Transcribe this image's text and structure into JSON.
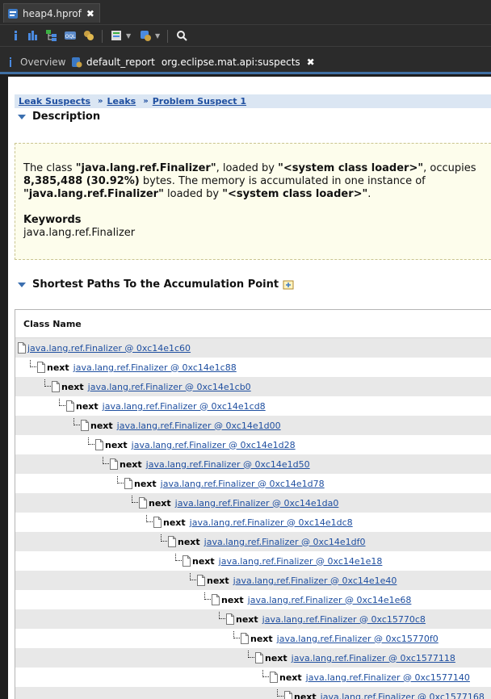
{
  "editor_tab": {
    "title": "heap4.hprof"
  },
  "inner_tabs": [
    {
      "label": "Overview"
    },
    {
      "label": "default_report",
      "sub": "org.eclipse.mat.api:suspects"
    }
  ],
  "breadcrumb": [
    "Leak Suspects",
    "Leaks",
    "Problem Suspect 1"
  ],
  "description": {
    "heading": "Description",
    "l1a": "The class ",
    "l1b": "\"java.lang.ref.Finalizer\"",
    "l1c": ", loaded by ",
    "l1d": "\"<system class loader>\"",
    "l1e": ", occupies",
    "l2a": "8,385,488 (30.92%)",
    "l2b": " bytes. The memory is accumulated in one instance of",
    "l3a": "\"java.lang.ref.Finalizer\"",
    "l3b": " loaded by ",
    "l3c": "\"<system class loader>\"",
    "l3d": ".",
    "keywords_title": "Keywords",
    "keywords": "java.lang.ref.Finalizer"
  },
  "paths": {
    "heading": "Shortest Paths To the Accumulation Point",
    "column": "Class Name",
    "next_label": "next",
    "rows": [
      "java.lang.ref.Finalizer @ 0xc14e1c60",
      "java.lang.ref.Finalizer @ 0xc14e1c88",
      "java.lang.ref.Finalizer @ 0xc14e1cb0",
      "java.lang.ref.Finalizer @ 0xc14e1cd8",
      "java.lang.ref.Finalizer @ 0xc14e1d00",
      "java.lang.ref.Finalizer @ 0xc14e1d28",
      "java.lang.ref.Finalizer @ 0xc14e1d50",
      "java.lang.ref.Finalizer @ 0xc14e1d78",
      "java.lang.ref.Finalizer @ 0xc14e1da0",
      "java.lang.ref.Finalizer @ 0xc14e1dc8",
      "java.lang.ref.Finalizer @ 0xc14e1df0",
      "java.lang.ref.Finalizer @ 0xc14e1e18",
      "java.lang.ref.Finalizer @ 0xc14e1e40",
      "java.lang.ref.Finalizer @ 0xc14e1e68",
      "java.lang.ref.Finalizer @ 0xc15770c8",
      "java.lang.ref.Finalizer @ 0xc15770f0",
      "java.lang.ref.Finalizer @ 0xc1577118",
      "java.lang.ref.Finalizer @ 0xc1577140",
      "java.lang.ref.Finalizer @ 0xc1577168"
    ]
  },
  "colors": {
    "link": "#1f4fa0",
    "accent": "#3f6fa3",
    "desc_bg": "#fdfdec",
    "row_alt": "#e8e8e8"
  },
  "icons": [
    "hprof-file-icon",
    "info-icon",
    "histogram-icon",
    "dominator-tree-icon",
    "oql-icon",
    "thread-overview-icon",
    "query-browser-icon",
    "heap-dump-icon",
    "search-icon",
    "report-icon",
    "pin-icon",
    "object-file-icon"
  ]
}
